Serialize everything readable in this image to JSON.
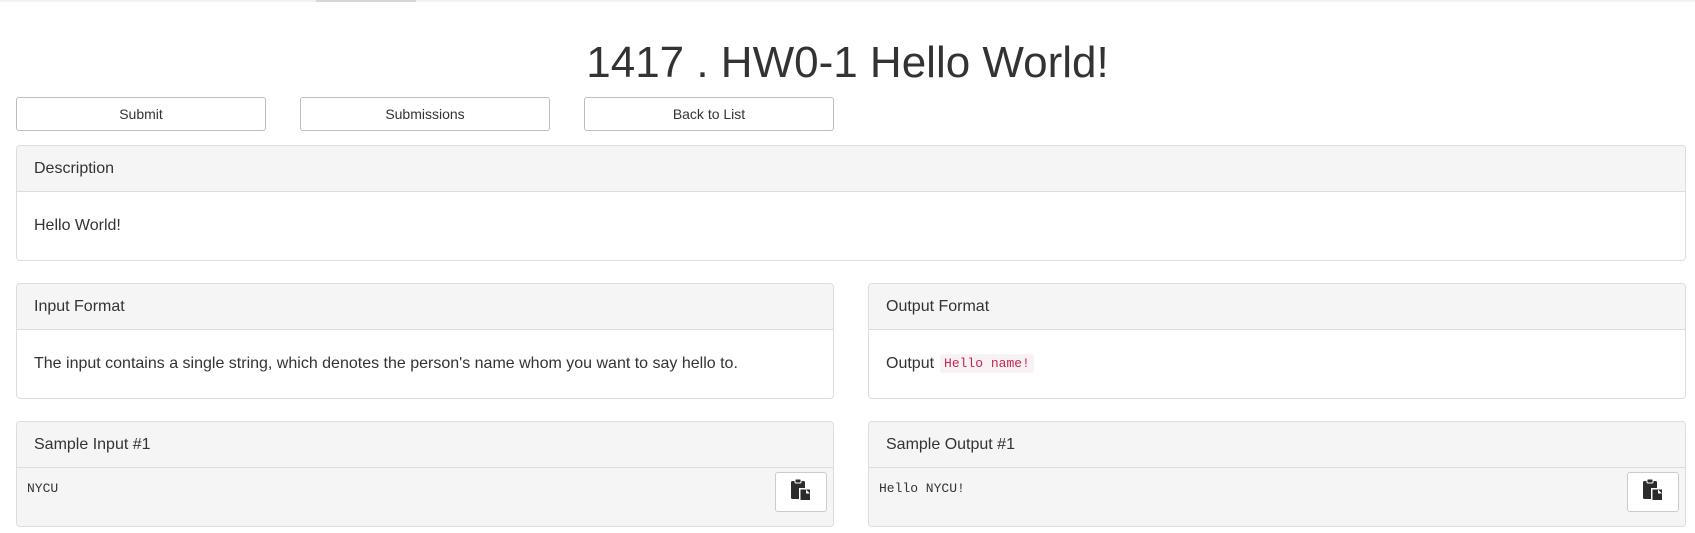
{
  "problem": {
    "title": "1417 . HW0-1 Hello World!"
  },
  "toolbar": {
    "submit_label": "Submit",
    "submissions_label": "Submissions",
    "back_label": "Back to List"
  },
  "description": {
    "heading": "Description",
    "text": "Hello World!"
  },
  "input_format": {
    "heading": "Input Format",
    "text": "The input contains a single string, which denotes the person's name whom you want to say hello to."
  },
  "output_format": {
    "heading": "Output Format",
    "prefix": "Output",
    "code": "Hello name!"
  },
  "samples": [
    {
      "input_heading": "Sample Input #1",
      "input_text": "NYCU",
      "output_heading": "Sample Output #1",
      "output_text": "Hello NYCU!"
    }
  ],
  "icons": {
    "copy": "clipboard-copy-icon"
  },
  "colors": {
    "inline_code_text": "#c7254e",
    "inline_code_bg": "#f9f2f4",
    "panel_heading_bg": "#f5f5f5"
  }
}
